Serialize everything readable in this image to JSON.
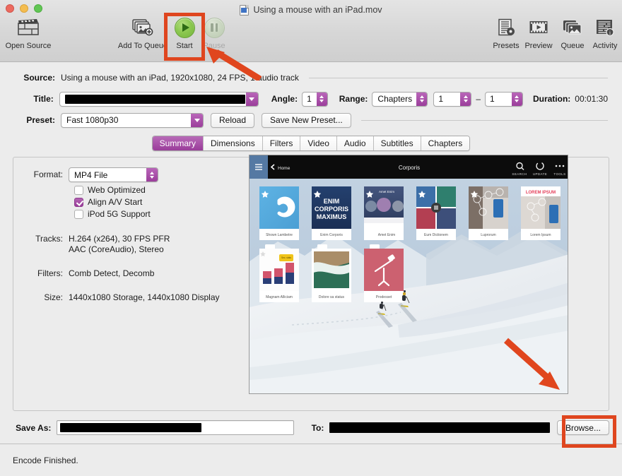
{
  "window": {
    "title": "Using a mouse with an iPad.mov",
    "doc_icon": "movie-document-icon"
  },
  "toolbar": {
    "open_source": "Open Source",
    "add_to_queue": "Add To Queue",
    "start": "Start",
    "pause": "Pause",
    "presets": "Presets",
    "preview": "Preview",
    "queue": "Queue",
    "activity": "Activity"
  },
  "settings": {
    "source_label": "Source:",
    "source_value": "Using a mouse with an iPad, 1920x1080, 24 FPS, 1 audio track",
    "title_label": "Title:",
    "title_value": "",
    "angle_label": "Angle:",
    "angle_value": "1",
    "range_label": "Range:",
    "range_value": "Chapters",
    "range_start": "1",
    "range_dash": "–",
    "range_end": "1",
    "duration_label": "Duration:",
    "duration_value": "00:01:30",
    "preset_label": "Preset:",
    "preset_value": "Fast 1080p30",
    "reload_label": "Reload",
    "save_preset_label": "Save New Preset..."
  },
  "tabs": [
    {
      "label": "Summary",
      "active": true
    },
    {
      "label": "Dimensions",
      "active": false
    },
    {
      "label": "Filters",
      "active": false
    },
    {
      "label": "Video",
      "active": false
    },
    {
      "label": "Audio",
      "active": false
    },
    {
      "label": "Subtitles",
      "active": false
    },
    {
      "label": "Chapters",
      "active": false
    }
  ],
  "summary": {
    "format_label": "Format:",
    "format_value": "MP4 File",
    "checkboxes": [
      {
        "label": "Web Optimized",
        "checked": false
      },
      {
        "label": "Align A/V Start",
        "checked": true
      },
      {
        "label": "iPod 5G Support",
        "checked": false
      }
    ],
    "tracks_label": "Tracks:",
    "tracks_video": "H.264 (x264), 30 FPS PFR",
    "tracks_audio": "AAC (CoreAudio), Stereo",
    "filters_label": "Filters:",
    "filters_value": "Comb Detect, Decomb",
    "size_label": "Size:",
    "size_value": "1440x1080 Storage, 1440x1080 Display"
  },
  "preview": {
    "nav_back": "Home",
    "nav_title": "Corporis",
    "nav_search": "SEARCH",
    "nav_update": "UPDATE",
    "nav_tools": "TOOLS",
    "cards_row1": [
      {
        "caption": "Shown Lambetre",
        "heading": ""
      },
      {
        "caption": "Enim Corporis",
        "heading": "ENIM CORPORIS MAXIMUS"
      },
      {
        "caption": "Amet Enim",
        "heading": "Amet Enim"
      },
      {
        "caption": "Eum Dictionem",
        "heading": ""
      },
      {
        "caption": "Luprorum",
        "heading": ""
      },
      {
        "caption": "Lorem Ipsum",
        "heading": "LOREM IPSUM"
      }
    ],
    "cards_row2": [
      {
        "caption": "Magnam Alliciam"
      },
      {
        "caption": "Dolore sa status"
      },
      {
        "caption": "Prodesset"
      }
    ]
  },
  "bottom": {
    "save_as_label": "Save As:",
    "save_as_value": "",
    "to_label": "To:",
    "to_value": "",
    "browse_label": "Browse...",
    "status": "Encode Finished."
  },
  "colors": {
    "accent_purple": "#9b3e9b",
    "highlight_red": "#df461f",
    "start_green": "#8cc850",
    "window_bg": "#ececec"
  }
}
